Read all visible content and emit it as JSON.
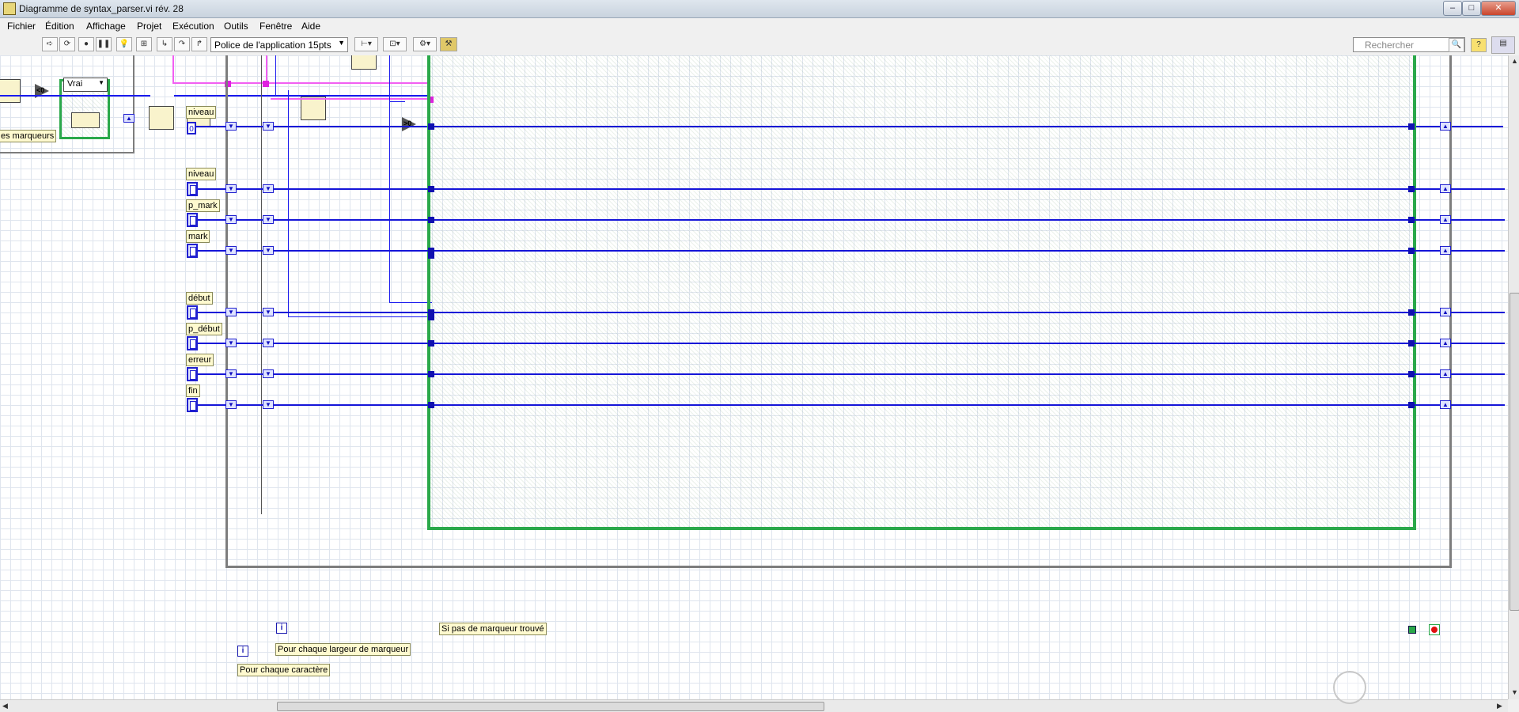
{
  "window": {
    "title": "Diagramme de syntax_parser.vi rév. 28",
    "minimize": "–",
    "maximize": "□",
    "close": "✕"
  },
  "menu": [
    "Fichier",
    "Édition",
    "Affichage",
    "Projet",
    "Exécution",
    "Outils",
    "Fenêtre",
    "Aide"
  ],
  "toolbar": {
    "font_label": "Police de l'application 15pts",
    "search_placeholder": "Rechercher"
  },
  "diagram": {
    "case_selector_value": "Vrai",
    "markers_label": "es marqueurs",
    "compare_lt0": "<0",
    "compare_gt0": ">0",
    "zero_const": "0",
    "indicators": [
      "niveau",
      "niveau",
      "p_mark",
      "mark",
      "début",
      "p_début",
      "erreur",
      "fin"
    ],
    "iter_label": "i",
    "outer_loop_label": "Pour chaque caractère",
    "inner_loop_label": "Pour chaque largeur de marqueur",
    "while_loop_label": "Si pas de marqueur trouvé",
    "colors": {
      "wire_int": "#1515d8",
      "wire_string": "#f25ff2",
      "while_border": "#2aa84a",
      "for_border": "#7d7d7d"
    }
  }
}
